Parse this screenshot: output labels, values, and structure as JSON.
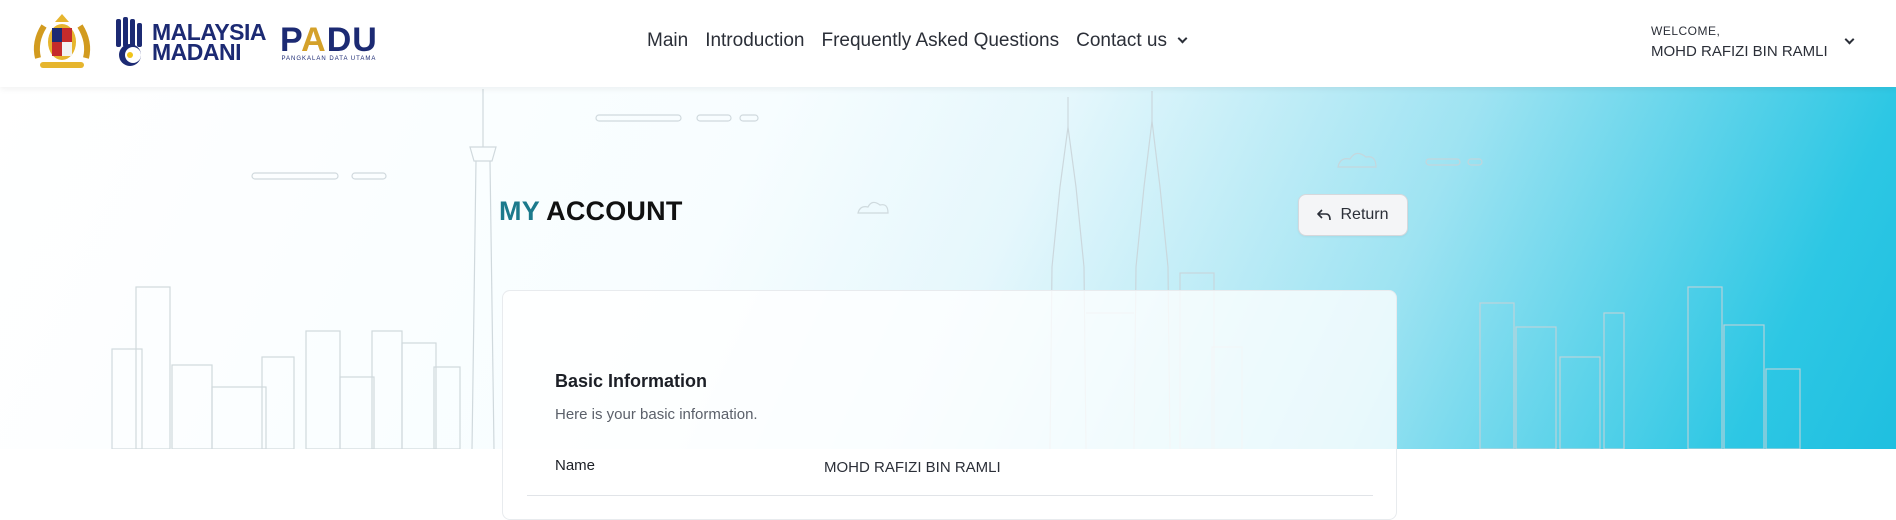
{
  "header": {
    "logos": {
      "crest_icon": "malaysia-coat-of-arms",
      "madani_text_1": "MALAYSIA",
      "madani_text_2": "MADANI",
      "padu_text": "PADU",
      "padu_subtitle": "PANGKALAN DATA UTAMA"
    },
    "nav": {
      "items": [
        {
          "label": "Main"
        },
        {
          "label": "Introduction"
        },
        {
          "label": "Frequently Asked Questions"
        },
        {
          "label": "Contact us"
        }
      ]
    },
    "user": {
      "welcome": "WELCOME,",
      "name": "MOHD RAFIZI BIN RAMLI"
    }
  },
  "page": {
    "title_highlight": "MY",
    "title_rest": "ACCOUNT",
    "return_label": "Return"
  },
  "card": {
    "heading": "Basic Information",
    "subheading": "Here is your basic information.",
    "rows": [
      {
        "label": "Name",
        "value": "MOHD RAFIZI BIN RAMLI"
      }
    ]
  },
  "colors": {
    "brand_navy": "#1c2a73",
    "title_accent": "#1b7a8c",
    "hero_cyan": "#1fbfe0"
  }
}
